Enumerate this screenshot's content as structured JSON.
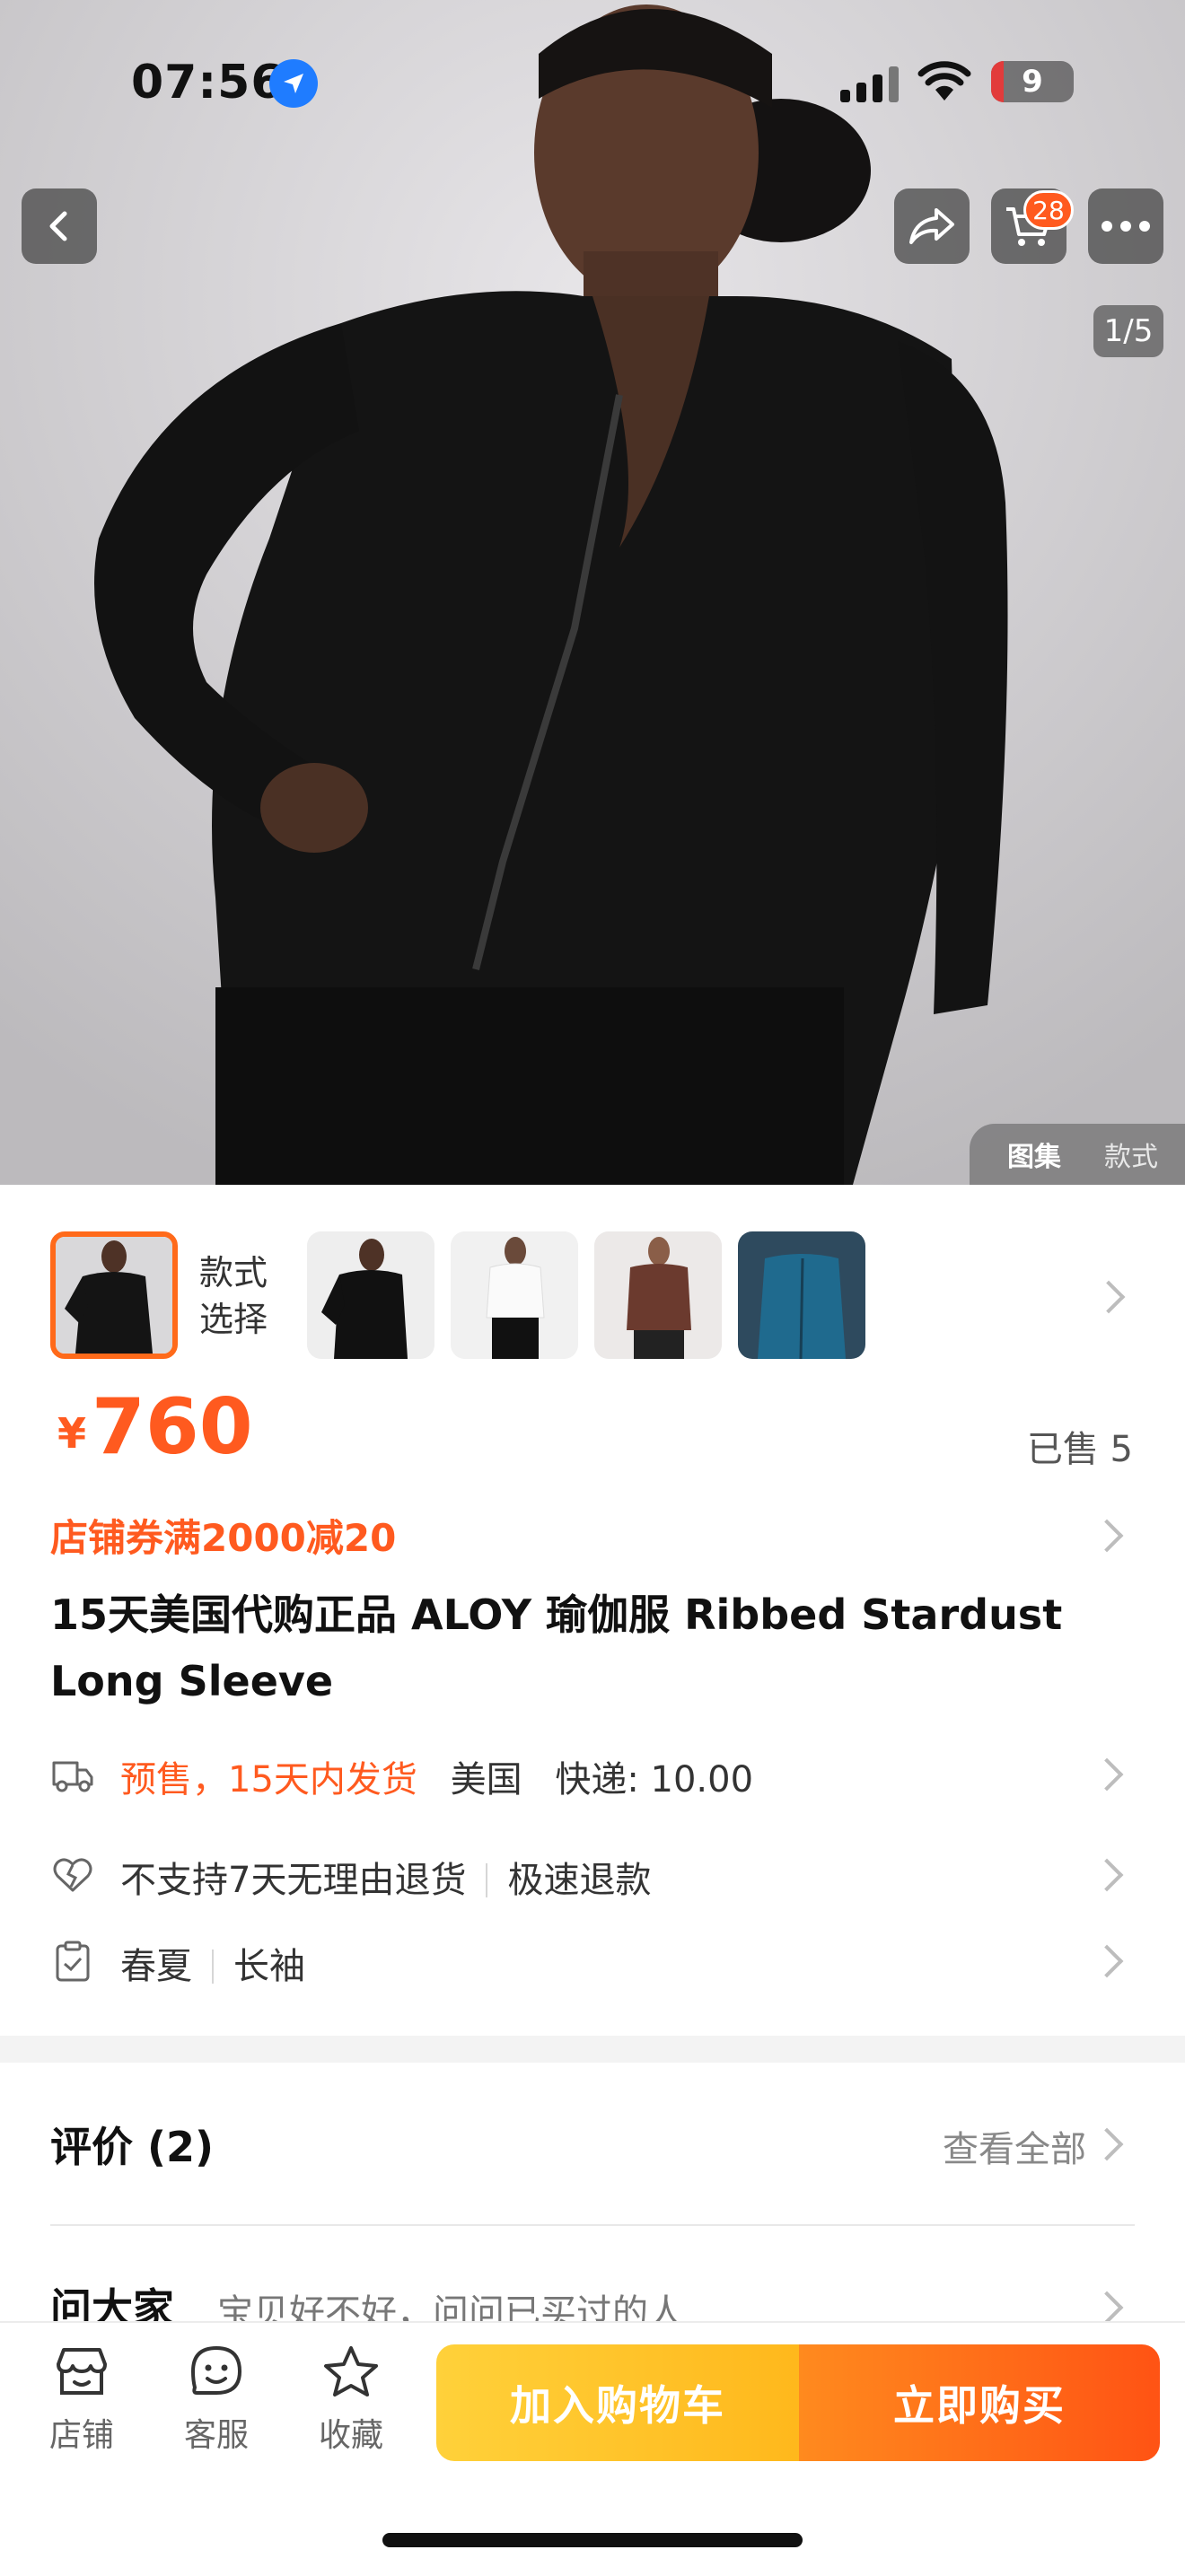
{
  "status_bar": {
    "time": "07:56",
    "battery": "9"
  },
  "header": {
    "cart_count": "28",
    "image_counter": "1/5"
  },
  "gallery_tabs": {
    "gallery": "图集",
    "style": "款式"
  },
  "styles": {
    "label": "款式选择"
  },
  "product": {
    "currency": "¥",
    "price": "760",
    "sold": "已售 5",
    "coupon": "店铺券满2000减20",
    "title": "15天美国代购正品 ALOY 瑜伽服 Ribbed Stardust Long Sleeve"
  },
  "shipping": {
    "presale": "预售，15天内发货",
    "origin": "美国",
    "fee": "快递: 10.00"
  },
  "returns": {
    "policy": "不支持7天无理由退货",
    "refund": "极速退款"
  },
  "attributes": {
    "season": "春夏",
    "sleeve": "长袖"
  },
  "reviews": {
    "title": "评价 (2)",
    "view_all": "查看全部"
  },
  "ask": {
    "title": "问大家",
    "subtitle": "宝贝好不好，问问已买过的人"
  },
  "bottom_bar": {
    "store": "店铺",
    "service": "客服",
    "favorite": "收藏",
    "add_to_cart": "加入购物车",
    "buy_now": "立即购买"
  },
  "colors": {
    "accent": "#ff5a1f",
    "cart_button": "#ffc12a",
    "buy_button": "#ff6a18"
  }
}
